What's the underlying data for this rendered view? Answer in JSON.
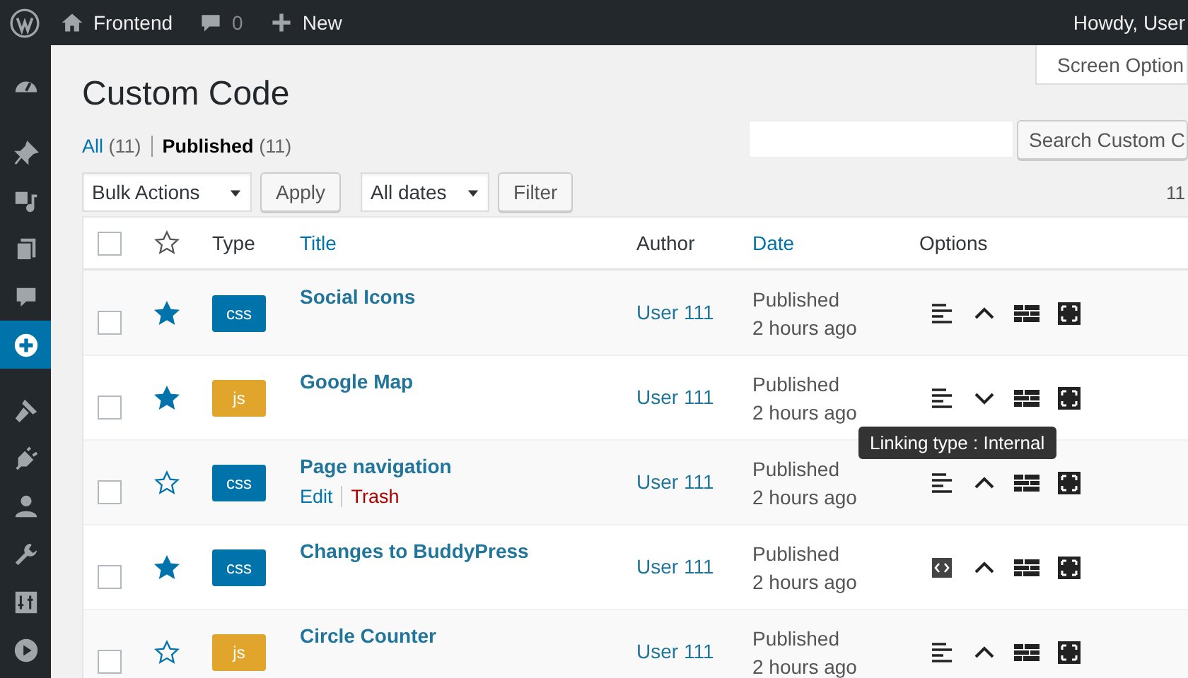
{
  "admin_bar": {
    "site": "Frontend",
    "comments": "0",
    "new": "New",
    "greeting": "Howdy, User"
  },
  "sidebar": {
    "items": [
      {
        "selected": false
      },
      {
        "selected": false
      },
      {
        "selected": false
      },
      {
        "selected": false
      },
      {
        "selected": false
      },
      {
        "selected": true
      },
      {
        "selected": false
      },
      {
        "selected": false
      },
      {
        "selected": false
      },
      {
        "selected": false
      },
      {
        "selected": false
      },
      {
        "selected": false
      }
    ]
  },
  "screen_options": "Screen Option",
  "title": "Custom Code",
  "views": [
    {
      "label": "All",
      "count": "(11)",
      "selected": false
    },
    {
      "label": "Published",
      "count": "(11)",
      "selected": true
    }
  ],
  "search_button": "Search Custom C",
  "bulk_actions": "Bulk Actions",
  "apply": "Apply",
  "dates": "All dates",
  "filter": "Filter",
  "item_count": "11",
  "select_all": {
    "checked": false
  },
  "columns": [
    {
      "label": "Type",
      "sortable": false
    },
    {
      "label": "Title",
      "sortable": true
    },
    {
      "label": "Author",
      "sortable": false
    },
    {
      "label": "Date",
      "sortable": true
    },
    {
      "label": "Options",
      "sortable": false
    }
  ],
  "rows": [
    {
      "checked": false,
      "starred": true,
      "type": {
        "label": "css",
        "kind": "css"
      },
      "title": "Social Icons",
      "author": "User 111",
      "status": "Published",
      "date": "2 hours ago",
      "options": [
        {
          "kind": "align"
        },
        {
          "kind": "chevron-up"
        },
        {
          "kind": "table"
        },
        {
          "kind": "expand"
        }
      ]
    },
    {
      "checked": false,
      "starred": true,
      "type": {
        "label": "js",
        "kind": "js"
      },
      "title": "Google Map",
      "author": "User 111",
      "status": "Published",
      "date": "2 hours ago",
      "options": [
        {
          "kind": "align"
        },
        {
          "kind": "chevron-down"
        },
        {
          "kind": "table"
        },
        {
          "kind": "expand"
        }
      ]
    },
    {
      "checked": false,
      "starred": false,
      "type": {
        "label": "css",
        "kind": "css"
      },
      "title": "Page navigation",
      "row_actions": [
        {
          "label": "Edit",
          "kind": "edit"
        },
        {
          "label": "Trash",
          "kind": "trash"
        }
      ],
      "tooltip": "Linking type : Internal",
      "author": "User 111",
      "status": "Published",
      "date": "2 hours ago",
      "options": [
        {
          "kind": "align"
        },
        {
          "kind": "chevron-up"
        },
        {
          "kind": "table"
        },
        {
          "kind": "expand"
        }
      ]
    },
    {
      "checked": false,
      "starred": true,
      "type": {
        "label": "css",
        "kind": "css"
      },
      "title": "Changes to BuddyPress",
      "author": "User 111",
      "status": "Published",
      "date": "2 hours ago",
      "options": [
        {
          "kind": "code"
        },
        {
          "kind": "chevron-up"
        },
        {
          "kind": "table"
        },
        {
          "kind": "expand"
        }
      ]
    },
    {
      "checked": false,
      "starred": false,
      "type": {
        "label": "js",
        "kind": "js"
      },
      "title": "Circle Counter",
      "author": "User 111",
      "status": "Published",
      "date": "2 hours ago",
      "options": [
        {
          "kind": "align"
        },
        {
          "kind": "chevron-up"
        },
        {
          "kind": "table"
        },
        {
          "kind": "expand"
        }
      ]
    }
  ]
}
